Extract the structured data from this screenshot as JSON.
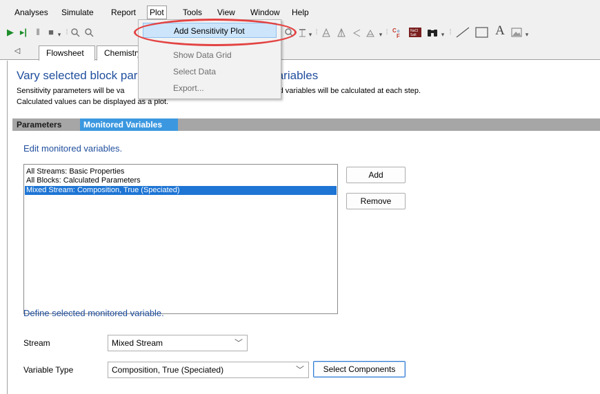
{
  "menubar": {
    "items": [
      "Analyses",
      "Simulate",
      "Report",
      "Plot",
      "Tools",
      "View",
      "Window",
      "Help"
    ]
  },
  "plot_menu": {
    "items": [
      "Add Sensitivity Plot",
      "Show Data Grid",
      "Select Data",
      "Export..."
    ]
  },
  "tabs": [
    "Flowsheet",
    "Chemistry"
  ],
  "form": {
    "heading_left": "Vary selected block par",
    "heading_right": "eam variables",
    "desc_line1_left": "Sensitivity parameters will be va",
    "desc_line1_right": "nd monitored variables will be calculated at each step.",
    "desc_line2": "Calculated values can be displayed as a plot."
  },
  "subtabs": {
    "parameters": "Parameters",
    "monitored": "Monitored Variables"
  },
  "monitored": {
    "edit_title": "Edit monitored variables.",
    "list": [
      "All Streams: Basic Properties",
      "All Blocks: Calculated Parameters",
      "Mixed Stream: Composition, True (Speciated)"
    ],
    "selected_index": 2,
    "add_label": "Add",
    "remove_label": "Remove",
    "define_title": "Define selected monitored variable.",
    "stream_label": "Stream",
    "stream_value": "Mixed Stream",
    "variable_type_label": "Variable Type",
    "variable_type_value": "Composition, True (Speciated)",
    "select_components_label": "Select Components"
  },
  "colors": {
    "accent_blue": "#1f4e9d",
    "selection": "#1e75d4",
    "subtab_active": "#3b98e0",
    "highlight_ring": "#e34343"
  },
  "icons": [
    "run-icon",
    "step-icon",
    "pause-icon",
    "stop-icon",
    "zoom-in-icon",
    "zoom-out-icon",
    "line-tool-icon",
    "rectangle-tool-icon",
    "text-tool-icon",
    "image-tool-icon",
    "binoculars-icon"
  ]
}
